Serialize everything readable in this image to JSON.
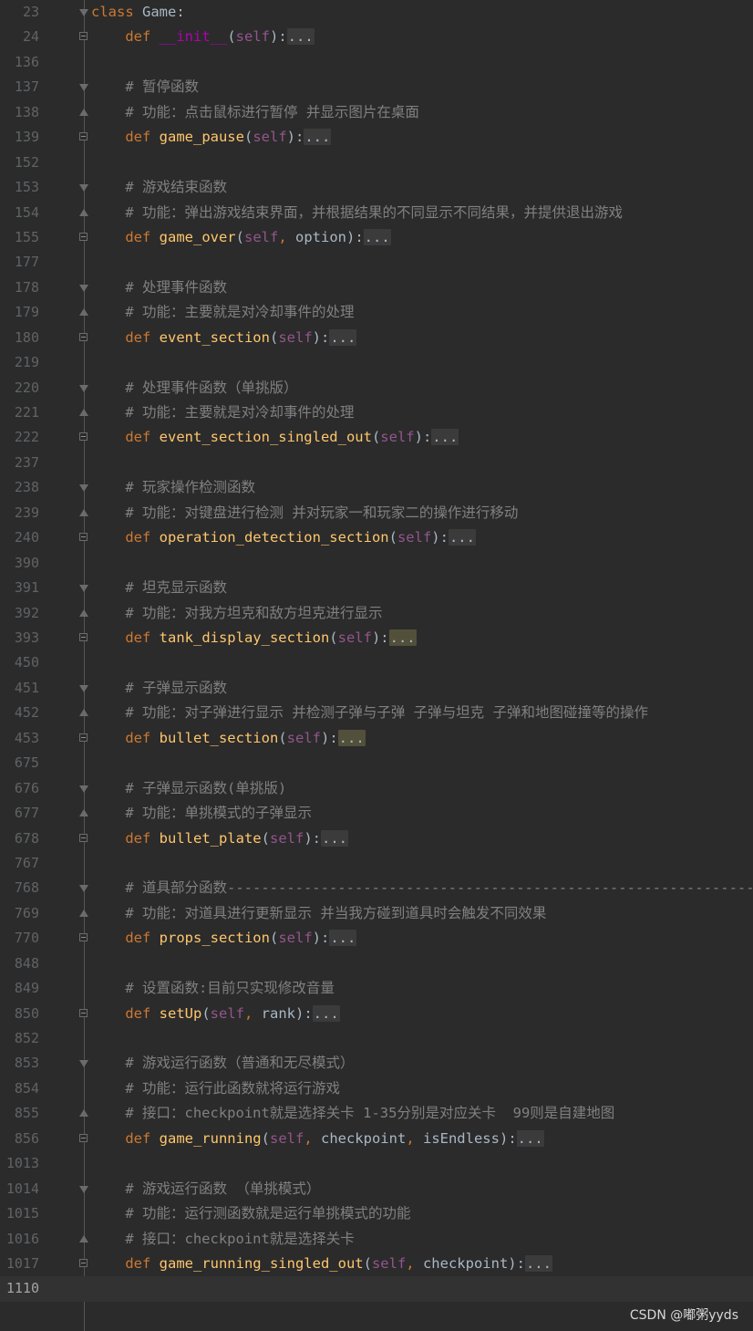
{
  "editor": {
    "lines": [
      {
        "num": "23",
        "fold": "tri-down",
        "tokens": [
          {
            "t": "class ",
            "c": "kw"
          },
          {
            "t": "Game",
            "c": "pl"
          },
          {
            "t": ":",
            "c": "pl"
          }
        ]
      },
      {
        "num": "24",
        "fold": "box",
        "tokens": [
          {
            "t": "    "
          },
          {
            "t": "def ",
            "c": "kw"
          },
          {
            "t": "__init__",
            "c": "magic"
          },
          {
            "t": "(",
            "c": "pl"
          },
          {
            "t": "self",
            "c": "self"
          },
          {
            "t": "):",
            "c": "pl"
          },
          {
            "t": "...",
            "c": "fold-dots"
          }
        ]
      },
      {
        "num": "136",
        "tokens": []
      },
      {
        "num": "137",
        "fold": "tri-down",
        "tokens": [
          {
            "t": "    "
          },
          {
            "t": "# 暂停函数",
            "c": "cm"
          }
        ]
      },
      {
        "num": "138",
        "fold": "tri-up",
        "tokens": [
          {
            "t": "    "
          },
          {
            "t": "# 功能：点击鼠标进行暂停 并显示图片在桌面",
            "c": "cm"
          }
        ]
      },
      {
        "num": "139",
        "fold": "box",
        "tokens": [
          {
            "t": "    "
          },
          {
            "t": "def ",
            "c": "kw"
          },
          {
            "t": "game_pause",
            "c": "fn"
          },
          {
            "t": "(",
            "c": "pl"
          },
          {
            "t": "self",
            "c": "self"
          },
          {
            "t": "):",
            "c": "pl"
          },
          {
            "t": "...",
            "c": "fold-dots"
          }
        ]
      },
      {
        "num": "152",
        "tokens": []
      },
      {
        "num": "153",
        "fold": "tri-down",
        "tokens": [
          {
            "t": "    "
          },
          {
            "t": "# 游戏结束函数",
            "c": "cm"
          }
        ]
      },
      {
        "num": "154",
        "fold": "tri-up",
        "tokens": [
          {
            "t": "    "
          },
          {
            "t": "# 功能：弹出游戏结束界面，并根据结果的不同显示不同结果，并提供退出游戏",
            "c": "cm"
          }
        ]
      },
      {
        "num": "155",
        "fold": "box",
        "tokens": [
          {
            "t": "    "
          },
          {
            "t": "def ",
            "c": "kw"
          },
          {
            "t": "game_over",
            "c": "fn"
          },
          {
            "t": "(",
            "c": "pl"
          },
          {
            "t": "self",
            "c": "self"
          },
          {
            "t": ", ",
            "c": "punct"
          },
          {
            "t": "option",
            "c": "pl"
          },
          {
            "t": "):",
            "c": "pl"
          },
          {
            "t": "...",
            "c": "fold-dots"
          }
        ]
      },
      {
        "num": "177",
        "tokens": []
      },
      {
        "num": "178",
        "fold": "tri-down",
        "tokens": [
          {
            "t": "    "
          },
          {
            "t": "# 处理事件函数",
            "c": "cm"
          }
        ]
      },
      {
        "num": "179",
        "fold": "tri-up",
        "tokens": [
          {
            "t": "    "
          },
          {
            "t": "# 功能：主要就是对冷却事件的处理",
            "c": "cm"
          }
        ]
      },
      {
        "num": "180",
        "fold": "box",
        "tokens": [
          {
            "t": "    "
          },
          {
            "t": "def ",
            "c": "kw"
          },
          {
            "t": "event_section",
            "c": "fn"
          },
          {
            "t": "(",
            "c": "pl"
          },
          {
            "t": "self",
            "c": "self"
          },
          {
            "t": "):",
            "c": "pl"
          },
          {
            "t": "...",
            "c": "fold-dots"
          }
        ]
      },
      {
        "num": "219",
        "tokens": []
      },
      {
        "num": "220",
        "fold": "tri-down",
        "tokens": [
          {
            "t": "    "
          },
          {
            "t": "# 处理事件函数（单挑版）",
            "c": "cm"
          }
        ]
      },
      {
        "num": "221",
        "fold": "tri-up",
        "tokens": [
          {
            "t": "    "
          },
          {
            "t": "# 功能：主要就是对冷却事件的处理",
            "c": "cm"
          }
        ]
      },
      {
        "num": "222",
        "fold": "box",
        "tokens": [
          {
            "t": "    "
          },
          {
            "t": "def ",
            "c": "kw"
          },
          {
            "t": "event_section_singled_out",
            "c": "fn"
          },
          {
            "t": "(",
            "c": "pl"
          },
          {
            "t": "self",
            "c": "self"
          },
          {
            "t": "):",
            "c": "pl"
          },
          {
            "t": "...",
            "c": "fold-dots"
          }
        ]
      },
      {
        "num": "237",
        "tokens": []
      },
      {
        "num": "238",
        "fold": "tri-down",
        "tokens": [
          {
            "t": "    "
          },
          {
            "t": "# 玩家操作检测函数",
            "c": "cm"
          }
        ]
      },
      {
        "num": "239",
        "fold": "tri-up",
        "tokens": [
          {
            "t": "    "
          },
          {
            "t": "# 功能：对键盘进行检测 并对玩家一和玩家二的操作进行移动",
            "c": "cm"
          }
        ]
      },
      {
        "num": "240",
        "fold": "box",
        "tokens": [
          {
            "t": "    "
          },
          {
            "t": "def ",
            "c": "kw"
          },
          {
            "t": "operation_detection_section",
            "c": "fn"
          },
          {
            "t": "(",
            "c": "pl"
          },
          {
            "t": "self",
            "c": "self"
          },
          {
            "t": "):",
            "c": "pl"
          },
          {
            "t": "...",
            "c": "fold-dots"
          }
        ]
      },
      {
        "num": "390",
        "tokens": []
      },
      {
        "num": "391",
        "fold": "tri-down",
        "tokens": [
          {
            "t": "    "
          },
          {
            "t": "# 坦克显示函数",
            "c": "cm"
          }
        ]
      },
      {
        "num": "392",
        "fold": "tri-up",
        "tokens": [
          {
            "t": "    "
          },
          {
            "t": "# 功能：对我方坦克和敌方坦克进行显示",
            "c": "cm"
          }
        ]
      },
      {
        "num": "393",
        "fold": "box",
        "tokens": [
          {
            "t": "    "
          },
          {
            "t": "def ",
            "c": "kw"
          },
          {
            "t": "tank_display_section",
            "c": "fn"
          },
          {
            "t": "(",
            "c": "pl"
          },
          {
            "t": "self",
            "c": "self"
          },
          {
            "t": "):",
            "c": "pl"
          },
          {
            "t": "...",
            "c": "fold-dots hl"
          }
        ]
      },
      {
        "num": "450",
        "tokens": []
      },
      {
        "num": "451",
        "fold": "tri-down",
        "tokens": [
          {
            "t": "    "
          },
          {
            "t": "# 子弹显示函数",
            "c": "cm"
          }
        ]
      },
      {
        "num": "452",
        "fold": "tri-up",
        "tokens": [
          {
            "t": "    "
          },
          {
            "t": "# 功能：对子弹进行显示 并检测子弹与子弹 子弹与坦克 子弹和地图碰撞等的操作",
            "c": "cm"
          }
        ]
      },
      {
        "num": "453",
        "fold": "box",
        "tokens": [
          {
            "t": "    "
          },
          {
            "t": "def ",
            "c": "kw"
          },
          {
            "t": "bullet_section",
            "c": "fn"
          },
          {
            "t": "(",
            "c": "pl"
          },
          {
            "t": "self",
            "c": "self"
          },
          {
            "t": "):",
            "c": "pl"
          },
          {
            "t": "...",
            "c": "fold-dots hl"
          }
        ]
      },
      {
        "num": "675",
        "tokens": []
      },
      {
        "num": "676",
        "fold": "tri-down",
        "tokens": [
          {
            "t": "    "
          },
          {
            "t": "# 子弹显示函数(单挑版)",
            "c": "cm"
          }
        ]
      },
      {
        "num": "677",
        "fold": "tri-up",
        "tokens": [
          {
            "t": "    "
          },
          {
            "t": "# 功能：单挑模式的子弹显示",
            "c": "cm"
          }
        ]
      },
      {
        "num": "678",
        "fold": "box",
        "tokens": [
          {
            "t": "    "
          },
          {
            "t": "def ",
            "c": "kw"
          },
          {
            "t": "bullet_plate",
            "c": "fn"
          },
          {
            "t": "(",
            "c": "pl"
          },
          {
            "t": "self",
            "c": "self"
          },
          {
            "t": "):",
            "c": "pl"
          },
          {
            "t": "...",
            "c": "fold-dots"
          }
        ]
      },
      {
        "num": "767",
        "tokens": []
      },
      {
        "num": "768",
        "fold": "tri-down",
        "tokens": [
          {
            "t": "    "
          },
          {
            "t": "# 道具部分函数---------------------------------------------------------------",
            "c": "cm"
          }
        ]
      },
      {
        "num": "769",
        "fold": "tri-up",
        "tokens": [
          {
            "t": "    "
          },
          {
            "t": "# 功能：对道具进行更新显示 并当我方碰到道具时会触发不同效果",
            "c": "cm"
          }
        ]
      },
      {
        "num": "770",
        "fold": "box",
        "tokens": [
          {
            "t": "    "
          },
          {
            "t": "def ",
            "c": "kw"
          },
          {
            "t": "props_section",
            "c": "fn"
          },
          {
            "t": "(",
            "c": "pl"
          },
          {
            "t": "self",
            "c": "self"
          },
          {
            "t": "):",
            "c": "pl"
          },
          {
            "t": "...",
            "c": "fold-dots"
          }
        ]
      },
      {
        "num": "848",
        "tokens": []
      },
      {
        "num": "849",
        "tokens": [
          {
            "t": "    "
          },
          {
            "t": "# 设置函数:目前只实现修改音量",
            "c": "cm"
          }
        ]
      },
      {
        "num": "850",
        "fold": "box",
        "tokens": [
          {
            "t": "    "
          },
          {
            "t": "def ",
            "c": "kw"
          },
          {
            "t": "setUp",
            "c": "fn"
          },
          {
            "t": "(",
            "c": "pl"
          },
          {
            "t": "self",
            "c": "self"
          },
          {
            "t": ", ",
            "c": "punct"
          },
          {
            "t": "rank",
            "c": "pl"
          },
          {
            "t": "):",
            "c": "pl"
          },
          {
            "t": "...",
            "c": "fold-dots"
          }
        ]
      },
      {
        "num": "852",
        "tokens": []
      },
      {
        "num": "853",
        "fold": "tri-down",
        "tokens": [
          {
            "t": "    "
          },
          {
            "t": "# 游戏运行函数（普通和无尽模式）",
            "c": "cm"
          }
        ]
      },
      {
        "num": "854",
        "tokens": [
          {
            "t": "    "
          },
          {
            "t": "# 功能：运行此函数就将运行游戏",
            "c": "cm"
          }
        ]
      },
      {
        "num": "855",
        "fold": "tri-up",
        "tokens": [
          {
            "t": "    "
          },
          {
            "t": "# 接口：checkpoint就是选择关卡 1-35分别是对应关卡  99则是自建地图",
            "c": "cm"
          }
        ]
      },
      {
        "num": "856",
        "fold": "box",
        "tokens": [
          {
            "t": "    "
          },
          {
            "t": "def ",
            "c": "kw"
          },
          {
            "t": "game_running",
            "c": "fn"
          },
          {
            "t": "(",
            "c": "pl"
          },
          {
            "t": "self",
            "c": "self"
          },
          {
            "t": ", ",
            "c": "punct"
          },
          {
            "t": "checkpoint",
            "c": "pl"
          },
          {
            "t": ", ",
            "c": "punct"
          },
          {
            "t": "isEndless",
            "c": "pl"
          },
          {
            "t": "):",
            "c": "pl"
          },
          {
            "t": "...",
            "c": "fold-dots"
          }
        ]
      },
      {
        "num": "1013",
        "tokens": []
      },
      {
        "num": "1014",
        "fold": "tri-down",
        "tokens": [
          {
            "t": "    "
          },
          {
            "t": "# 游戏运行函数 （单挑模式）",
            "c": "cm"
          }
        ]
      },
      {
        "num": "1015",
        "tokens": [
          {
            "t": "    "
          },
          {
            "t": "# 功能：运行测函数就是运行单挑模式的功能",
            "c": "cm"
          }
        ]
      },
      {
        "num": "1016",
        "fold": "tri-up",
        "tokens": [
          {
            "t": "    "
          },
          {
            "t": "# 接口：checkpoint就是选择关卡",
            "c": "cm"
          }
        ]
      },
      {
        "num": "1017",
        "fold": "box",
        "tokens": [
          {
            "t": "    "
          },
          {
            "t": "def ",
            "c": "kw"
          },
          {
            "t": "game_running_singled_out",
            "c": "fn"
          },
          {
            "t": "(",
            "c": "pl"
          },
          {
            "t": "self",
            "c": "self"
          },
          {
            "t": ", ",
            "c": "punct"
          },
          {
            "t": "checkpoint",
            "c": "pl"
          },
          {
            "t": "):",
            "c": "pl"
          },
          {
            "t": "...",
            "c": "fold-dots"
          }
        ]
      },
      {
        "num": "1110",
        "current": true,
        "tokens": []
      }
    ]
  },
  "watermark": "CSDN @嘟粥yyds",
  "colors": {
    "background": "#2b2b2b",
    "keyword": "#cc7832",
    "function": "#ffc66d",
    "comment": "#808080",
    "self": "#94558d",
    "magic": "#b200b2",
    "plain": "#a9b7c6"
  }
}
